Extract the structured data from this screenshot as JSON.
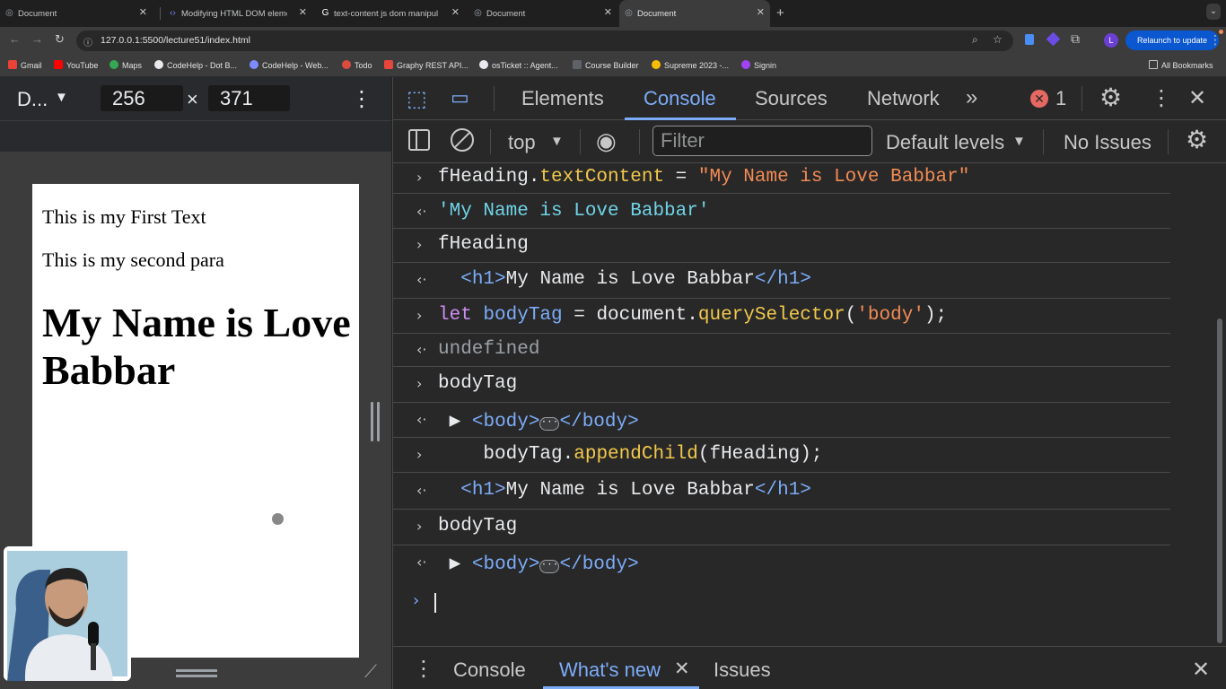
{
  "tabs": [
    {
      "title": "Document",
      "active": false
    },
    {
      "title": "Modifying HTML DOM eleme",
      "active": false
    },
    {
      "title": "text-content js dom manipul",
      "active": false
    },
    {
      "title": "Document",
      "active": false
    },
    {
      "title": "Document",
      "active": true
    }
  ],
  "address": {
    "url": "127.0.0.1:5500/lecture51/index.html",
    "relaunch_label": "Relaunch to update",
    "profile": "L"
  },
  "bookmarks": [
    "Gmail",
    "YouTube",
    "Maps",
    "CodeHelp - Dot B...",
    "CodeHelp - Web...",
    "Todo",
    "Graphy REST API...",
    "osTicket :: Agent...",
    "Course Builder",
    "Supreme 2023 -...",
    "Signin"
  ],
  "all_bookmarks": "All Bookmarks",
  "device": {
    "name": "D...",
    "width": "256",
    "height": "371"
  },
  "page": {
    "para1": "This is my First Text",
    "para2": "This is my second para",
    "heading": "My Name is Love Babbar"
  },
  "devtools": {
    "tabs": [
      "Elements",
      "Console",
      "Sources",
      "Network"
    ],
    "active_tab": "Console",
    "error_count": "1",
    "context": "top",
    "filter_placeholder": "Filter",
    "levels": "Default levels",
    "issues": "No Issues"
  },
  "console": [
    {
      "dir": "in",
      "parts": [
        [
          "t",
          "fHeading."
        ],
        [
          "mt",
          "textContent"
        ],
        [
          "t",
          " = "
        ],
        [
          "st",
          "\"My Name is Love Babbar\""
        ]
      ]
    },
    {
      "dir": "out",
      "parts": [
        [
          "str2",
          "'My Name is Love Babbar'"
        ]
      ]
    },
    {
      "dir": "in",
      "parts": [
        [
          "t",
          "fHeading"
        ]
      ]
    },
    {
      "dir": "out",
      "parts": [
        [
          "t",
          "  "
        ],
        [
          "tg",
          "<h1>"
        ],
        [
          "t",
          "My Name is Love Babbar"
        ],
        [
          "tg",
          "</h1>"
        ]
      ]
    },
    {
      "dir": "in",
      "parts": [
        [
          "kw",
          "let"
        ],
        [
          "t",
          " "
        ],
        [
          "pr2",
          "bodyTag"
        ],
        [
          "t",
          " = document."
        ],
        [
          "mt",
          "querySelector"
        ],
        [
          "t",
          "("
        ],
        [
          "st",
          "'body'"
        ],
        [
          "t",
          ");"
        ]
      ]
    },
    {
      "dir": "out",
      "parts": [
        [
          "gr",
          "undefined"
        ]
      ]
    },
    {
      "dir": "in",
      "parts": [
        [
          "t",
          "bodyTag"
        ]
      ]
    },
    {
      "dir": "out",
      "parts": [
        [
          "t",
          " ▶ "
        ],
        [
          "tg",
          "<body>"
        ],
        [
          "ell",
          "···"
        ],
        [
          "tg",
          "</body>"
        ]
      ]
    },
    {
      "dir": "in",
      "parts": [
        [
          "t",
          "    bodyTag."
        ],
        [
          "mt",
          "appendChild"
        ],
        [
          "t",
          "(fHeading);"
        ]
      ]
    },
    {
      "dir": "out",
      "parts": [
        [
          "t",
          "  "
        ],
        [
          "tg",
          "<h1>"
        ],
        [
          "t",
          "My Name is Love Babbar"
        ],
        [
          "tg",
          "</h1>"
        ]
      ]
    },
    {
      "dir": "in",
      "parts": [
        [
          "t",
          "bodyTag"
        ]
      ]
    },
    {
      "dir": "out",
      "parts": [
        [
          "t",
          " ▶ "
        ],
        [
          "tg",
          "<body>"
        ],
        [
          "ell",
          "···"
        ],
        [
          "tg",
          "</body>"
        ]
      ]
    }
  ],
  "drawer": {
    "tabs": [
      "Console",
      "What's new",
      "Issues"
    ],
    "active": "What's new"
  },
  "colors": {
    "accent": "#7cacf8",
    "error": "#e46962",
    "relaunch": "#0b57d0"
  }
}
